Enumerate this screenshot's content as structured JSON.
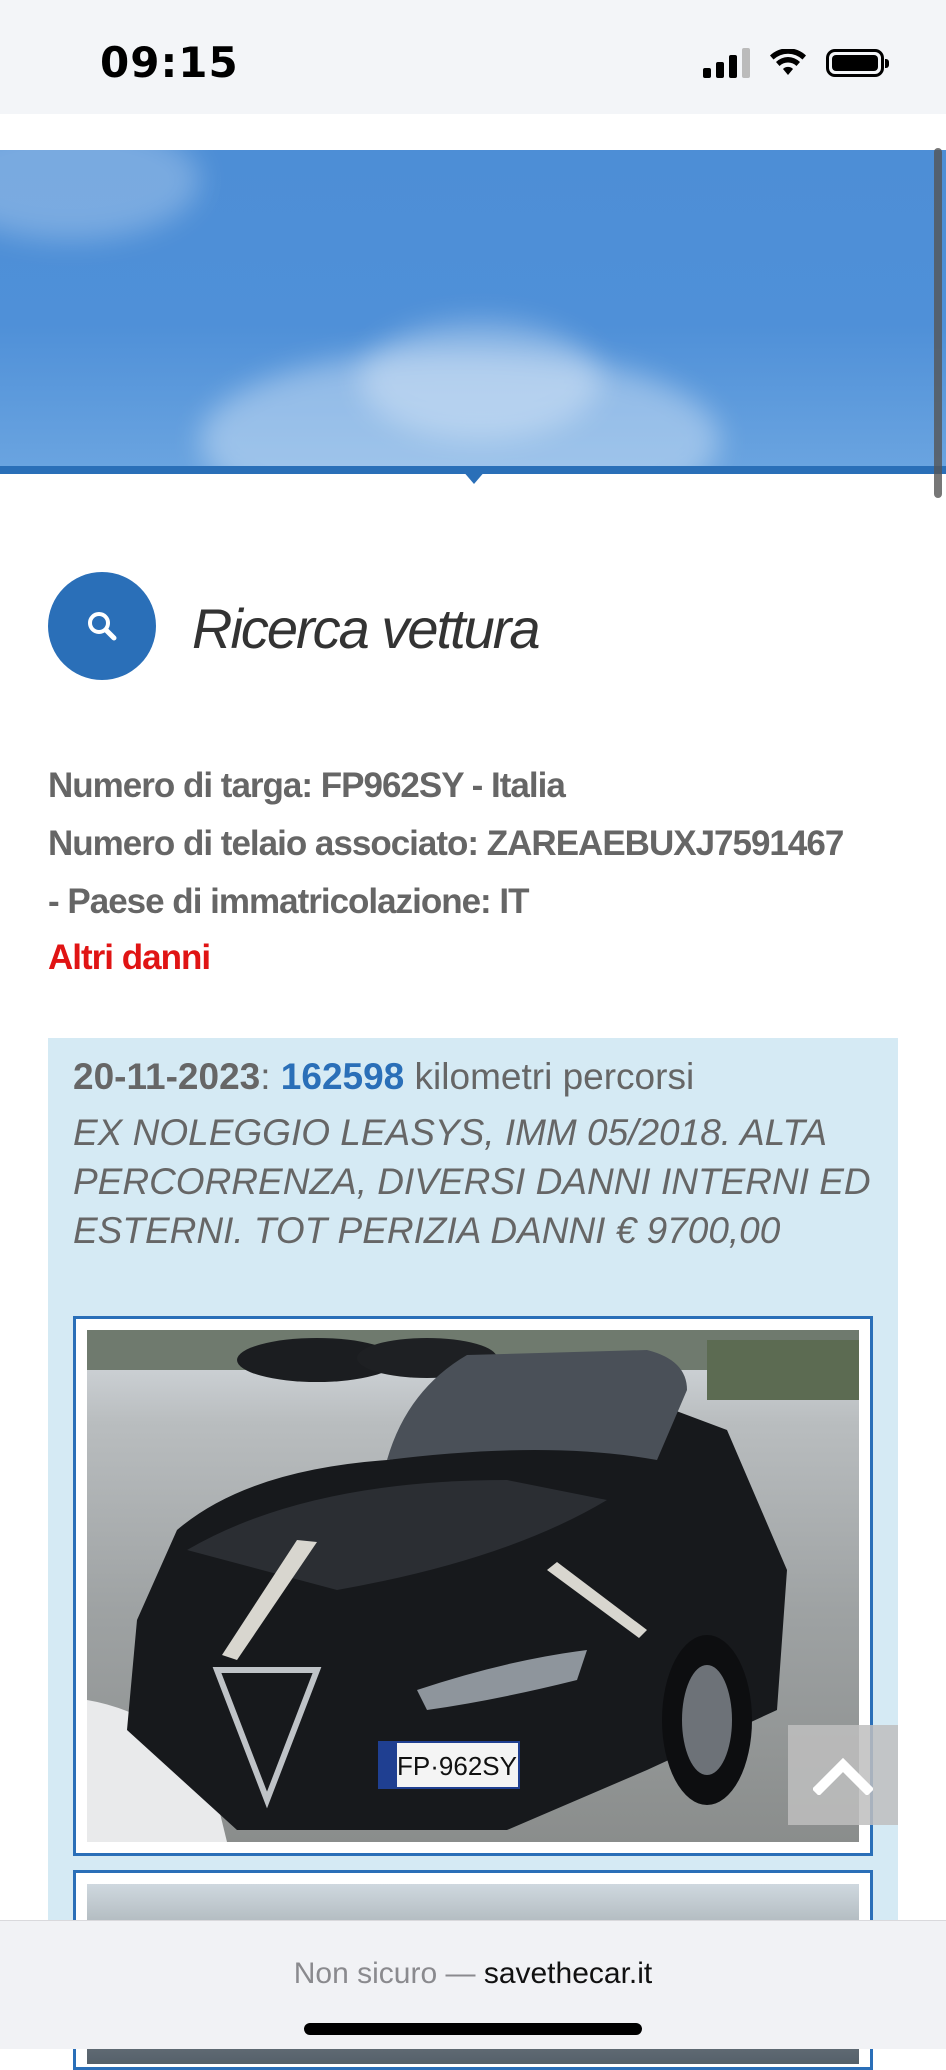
{
  "status_bar": {
    "time": "09:15"
  },
  "search": {
    "title": "Ricerca vettura"
  },
  "vehicle": {
    "plate_line": "Numero di targa: FP962SY - Italia",
    "vin_line": "Numero di telaio associato: ZAREAEBUXJ7591467",
    "country_line": "- Paese di immatricolazione: IT",
    "damage_label": "Altri danni"
  },
  "record": {
    "date": "20-11-2023",
    "separator": ": ",
    "km": "162598",
    "km_label": " kilometri percorsi",
    "description": "EX NOLEGGIO LEASYS, IMM 05/2018. ALTA PERCORRENZA, DIVERSI DANNI INTERNI ED ESTERNI. TOT PERIZIA DANNI € 9700,00",
    "photo_plate": "FP·962SY"
  },
  "browser": {
    "security": "Non sicuro — ",
    "domain": "savethecar.it"
  },
  "colors": {
    "brand": "#2a6fb8",
    "danger": "#e01414",
    "record_bg": "#d5eaf4"
  }
}
